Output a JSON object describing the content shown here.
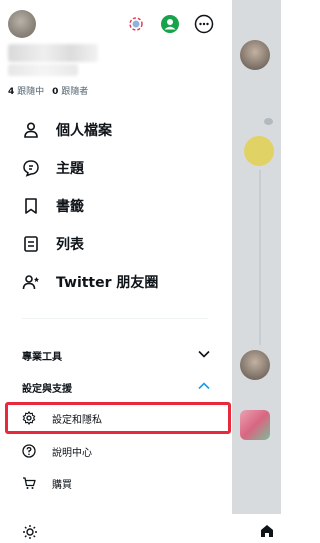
{
  "profile": {
    "following_count": "4",
    "following_label": "跟隨中",
    "followers_count": "0",
    "followers_label": "跟隨者"
  },
  "top_icons": [
    "switch-account-icon",
    "account-avatar-icon",
    "more-options-icon"
  ],
  "menu": {
    "items": [
      {
        "label": "個人檔案",
        "icon": "person-icon"
      },
      {
        "label": "主題",
        "icon": "topics-icon"
      },
      {
        "label": "書籤",
        "icon": "bookmark-icon"
      },
      {
        "label": "列表",
        "icon": "list-icon"
      },
      {
        "label": "Twitter 朋友圈",
        "icon": "circle-friends-icon"
      }
    ]
  },
  "sections": {
    "pro_tools": {
      "label": "專業工具",
      "state": "collapsed"
    },
    "settings_support": {
      "label": "設定與支援",
      "state": "expanded",
      "items": [
        {
          "label": "設定和隱私",
          "icon": "gear-icon",
          "highlighted": true
        },
        {
          "label": "說明中心",
          "icon": "help-icon"
        },
        {
          "label": "購買",
          "icon": "cart-icon"
        }
      ]
    }
  },
  "colors": {
    "highlight": "#e8293b",
    "secondary_text": "#536471",
    "account_green": "#17a34a"
  }
}
